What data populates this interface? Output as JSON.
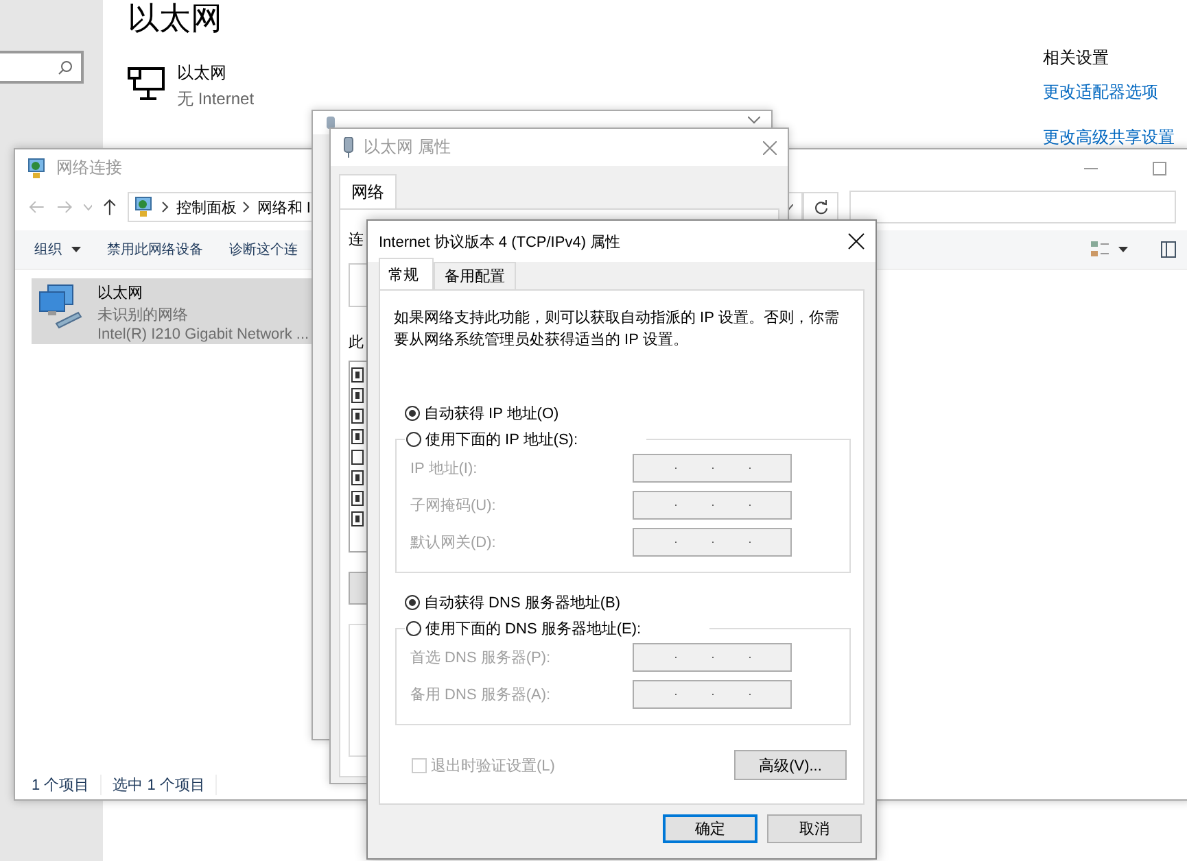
{
  "settings": {
    "title": "以太网",
    "connection": {
      "name": "以太网",
      "status": "无 Internet"
    },
    "related": {
      "heading": "相关设置",
      "links": [
        "更改适配器选项",
        "更改高级共享设置"
      ]
    }
  },
  "network_connections": {
    "title": "网络连接",
    "breadcrumb": [
      "控制面板",
      "网络和 I"
    ],
    "toolbar": [
      {
        "label": "组织",
        "dropdown": true
      },
      {
        "label": "禁用此网络设备",
        "dropdown": false
      },
      {
        "label": "诊断这个连",
        "dropdown": false
      }
    ],
    "items": [
      {
        "name": "以太网",
        "status": "未识别的网络",
        "device": "Intel(R) I210 Gigabit Network ...",
        "selected": true
      }
    ],
    "status_bar": [
      "1 个项目",
      "选中 1 个项目"
    ]
  },
  "properties_window": {
    "title": "以太网 属性",
    "tabs": [
      {
        "label": "网络",
        "selected": true
      }
    ],
    "connect_label": "连",
    "items_label": "此",
    "components": [
      {
        "checked": true
      },
      {
        "checked": true
      },
      {
        "checked": true
      },
      {
        "checked": true
      },
      {
        "checked": false
      },
      {
        "checked": true
      },
      {
        "checked": true
      },
      {
        "checked": true
      }
    ]
  },
  "ipv4_window": {
    "title": "Internet 协议版本 4 (TCP/IPv4) 属性",
    "tabs": [
      {
        "label": "常规",
        "selected": true
      },
      {
        "label": "备用配置",
        "selected": false
      }
    ],
    "description": "如果网络支持此功能，则可以获取自动指派的 IP 设置。否则，你需要从网络系统管理员处获得适当的 IP 设置。",
    "ip_options": [
      {
        "label": "自动获得 IP 地址(O)",
        "selected": true
      },
      {
        "label": "使用下面的 IP 地址(S):",
        "selected": false
      }
    ],
    "ip_fields": [
      {
        "label": "IP 地址(I):",
        "disabled": true
      },
      {
        "label": "子网掩码(U):",
        "disabled": true
      },
      {
        "label": "默认网关(D):",
        "disabled": true
      }
    ],
    "dns_options": [
      {
        "label": "自动获得 DNS 服务器地址(B)",
        "selected": true
      },
      {
        "label": "使用下面的 DNS 服务器地址(E):",
        "selected": false
      }
    ],
    "dns_fields": [
      {
        "label": "首选 DNS 服务器(P):",
        "disabled": true
      },
      {
        "label": "备用 DNS 服务器(A):",
        "disabled": true
      }
    ],
    "validate": {
      "label": "退出时验证设置(L)",
      "checked": false,
      "disabled": true
    },
    "advanced_button": "高级(V)...",
    "buttons": [
      {
        "label": "确定",
        "default": true
      },
      {
        "label": "取消",
        "default": false
      }
    ]
  }
}
